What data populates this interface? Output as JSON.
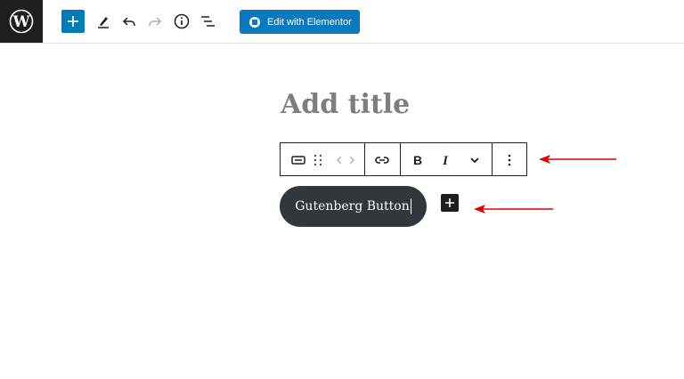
{
  "topbar": {
    "logo_icon": "wordpress-logo-icon",
    "tools": [
      "add-block-icon",
      "pencil-icon",
      "undo-icon",
      "redo-icon",
      "info-icon",
      "list-view-icon"
    ],
    "elementor_label": "Edit with Elementor"
  },
  "editor": {
    "title_placeholder": "Add title",
    "button_text": "Gutenberg Button"
  },
  "block_toolbar": {
    "icons": [
      "button-block-icon",
      "drag-handle-icon",
      "move-arrows-icon",
      "link-icon",
      "bold-icon",
      "italic-icon",
      "chevron-down-icon",
      "more-options-icon"
    ]
  },
  "colors": {
    "accent": "#007cba",
    "elementor": "#0a79c0",
    "button_bg": "#32373c",
    "annotation_arrow": "#e00000"
  }
}
